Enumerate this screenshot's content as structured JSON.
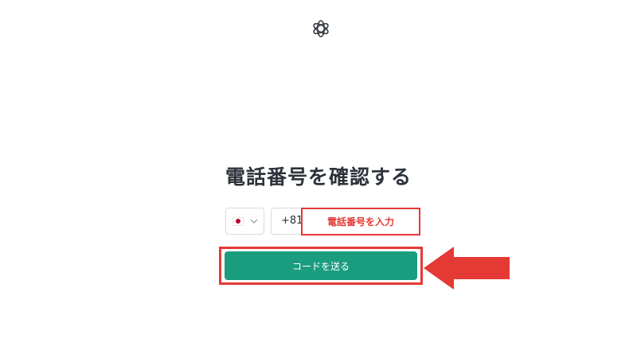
{
  "header": {
    "logo_icon": "openai-logo-icon"
  },
  "main": {
    "title": "電話番号を確認する",
    "country": {
      "flag": "japan-flag-icon",
      "chevron": "chevron-down-icon"
    },
    "dial_code": "+81",
    "phone": {
      "placeholder": "電話番号を入力",
      "value": ""
    },
    "send_button": {
      "label": "コードを送る"
    }
  },
  "annotations": {
    "arrow_icon": "arrow-left-icon"
  },
  "colors": {
    "accent": "#1a9d7e",
    "highlight": "#e53935",
    "text": "#2d333a",
    "border": "#d9d9e3"
  }
}
